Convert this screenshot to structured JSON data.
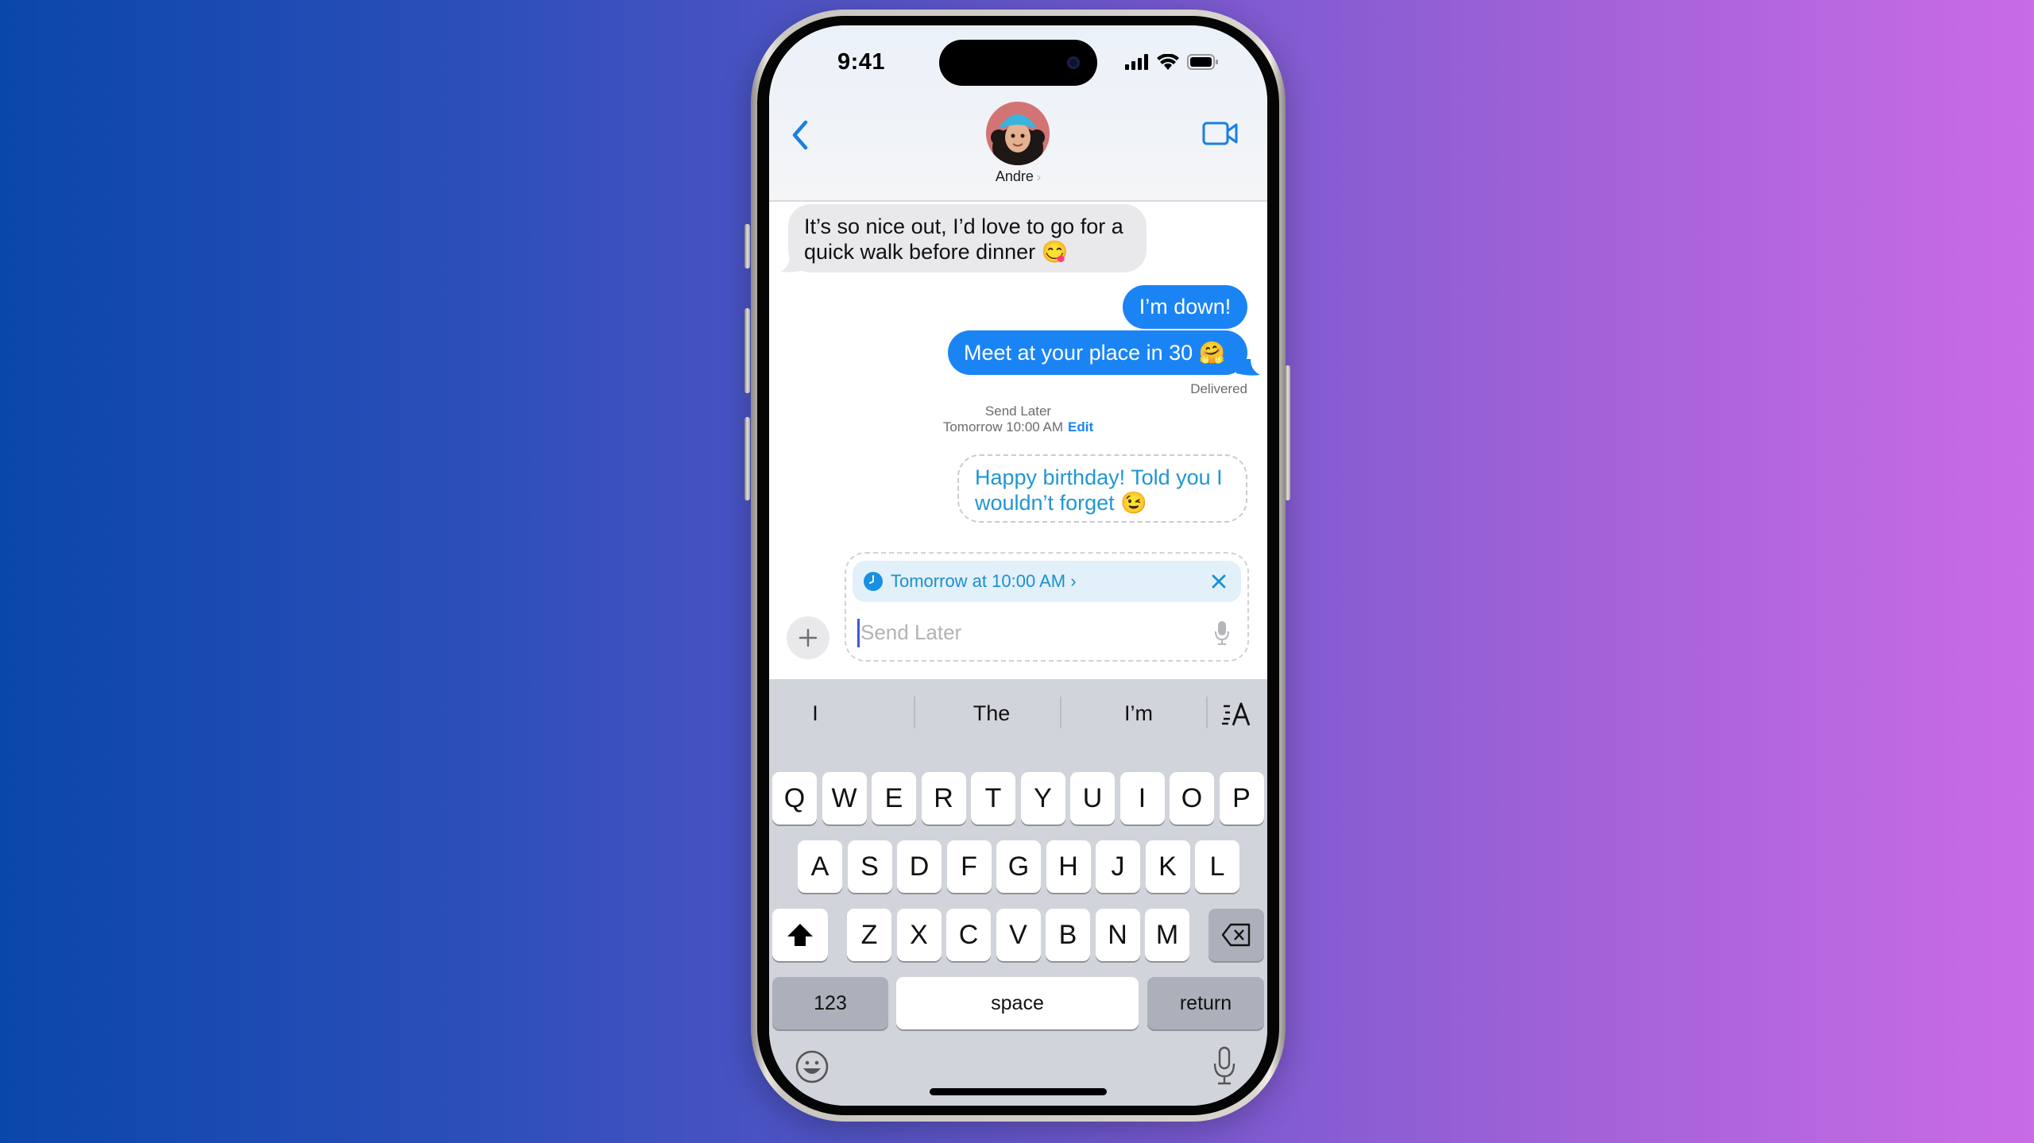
{
  "status_bar": {
    "time": "9:41"
  },
  "header": {
    "back_icon": "chevron-left-icon",
    "contact_name": "Andre",
    "contact_chevron": "›",
    "video_icon": "video-camera-icon"
  },
  "messages": [
    {
      "direction": "incoming",
      "text": "It’s so nice out, I’d love to go for a quick walk before dinner 😋"
    },
    {
      "direction": "outgoing",
      "text": "I’m down!"
    },
    {
      "direction": "outgoing",
      "text": "Meet at your place in 30 🤗"
    }
  ],
  "delivery_status": "Delivered",
  "send_later": {
    "label": "Send Later",
    "time": "Tomorrow 10:00 AM",
    "edit_label": "Edit",
    "scheduled_message": "Happy birthday! Told you I wouldn’t forget 😉"
  },
  "compose": {
    "schedule_pill": "Tomorrow at 10:00 AM ›",
    "placeholder": "Send Later",
    "value": ""
  },
  "keyboard": {
    "suggestions": [
      "I",
      "The",
      "I’m"
    ],
    "row1": [
      "Q",
      "W",
      "E",
      "R",
      "T",
      "Y",
      "U",
      "I",
      "O",
      "P"
    ],
    "row2": [
      "A",
      "S",
      "D",
      "F",
      "G",
      "H",
      "J",
      "K",
      "L"
    ],
    "row3": [
      "Z",
      "X",
      "C",
      "V",
      "B",
      "N",
      "M"
    ],
    "numbers_label": "123",
    "space_label": "space",
    "return_label": "return"
  },
  "colors": {
    "accent": "#1a84f5",
    "scheduled_text": "#2196d3",
    "incoming_bubble": "#e9e9eb",
    "keyboard_bg": "#d1d4da"
  }
}
